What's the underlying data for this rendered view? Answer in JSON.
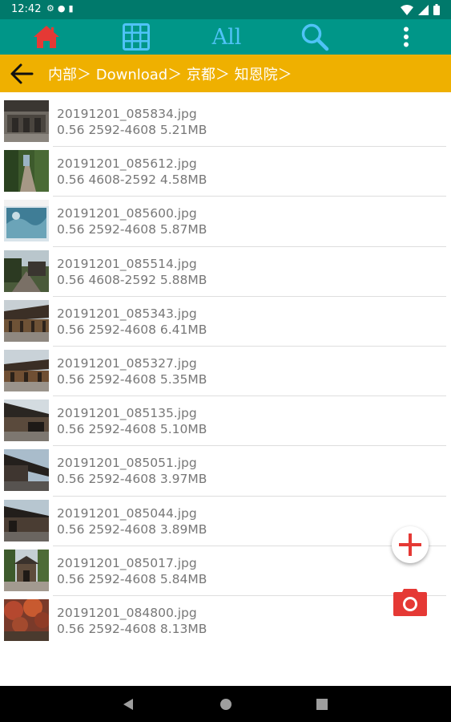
{
  "status_bar": {
    "time": "12:42",
    "left_icons": [
      "settings-icon",
      "notification-icon",
      "sd-card-icon"
    ],
    "right_icons": [
      "wifi-icon",
      "signal-icon",
      "battery-icon"
    ]
  },
  "toolbar": {
    "home_icon": "home-icon",
    "grid_icon": "grid-icon",
    "filter_label": "All",
    "search_icon": "search-icon",
    "more_icon": "more-vertical-icon",
    "home_color": "#e53935",
    "accent_color": "#4fc3f7",
    "background": "#009688"
  },
  "path_bar": {
    "back_icon": "back-arrow-icon",
    "path": "内部＞ Download＞ 京都＞ 知恩院＞",
    "background": "#efb000"
  },
  "files": [
    {
      "name": "20191201_085834.jpg",
      "meta": "0.56 2592-4608  5.21MB"
    },
    {
      "name": "20191201_085612.jpg",
      "meta": "0.56 4608-2592  4.58MB"
    },
    {
      "name": "20191201_085600.jpg",
      "meta": "0.56 2592-4608  5.87MB"
    },
    {
      "name": "20191201_085514.jpg",
      "meta": "0.56 4608-2592  5.88MB"
    },
    {
      "name": "20191201_085343.jpg",
      "meta": "0.56 2592-4608  6.41MB"
    },
    {
      "name": "20191201_085327.jpg",
      "meta": "0.56 2592-4608  5.35MB"
    },
    {
      "name": "20191201_085135.jpg",
      "meta": "0.56 2592-4608  5.10MB"
    },
    {
      "name": "20191201_085051.jpg",
      "meta": "0.56 2592-4608  3.97MB"
    },
    {
      "name": "20191201_085044.jpg",
      "meta": "0.56 2592-4608  3.89MB"
    },
    {
      "name": "20191201_085017.jpg",
      "meta": "0.56 2592-4608  5.84MB"
    },
    {
      "name": "20191201_084800.jpg",
      "meta": "0.56 2592-4608  8.13MB"
    }
  ],
  "fab": {
    "add_icon": "plus-icon",
    "camera_icon": "camera-icon",
    "color": "#e53935"
  },
  "nav_bar": {
    "back_icon": "nav-back-icon",
    "home_icon": "nav-home-icon",
    "recents_icon": "nav-recents-icon"
  }
}
